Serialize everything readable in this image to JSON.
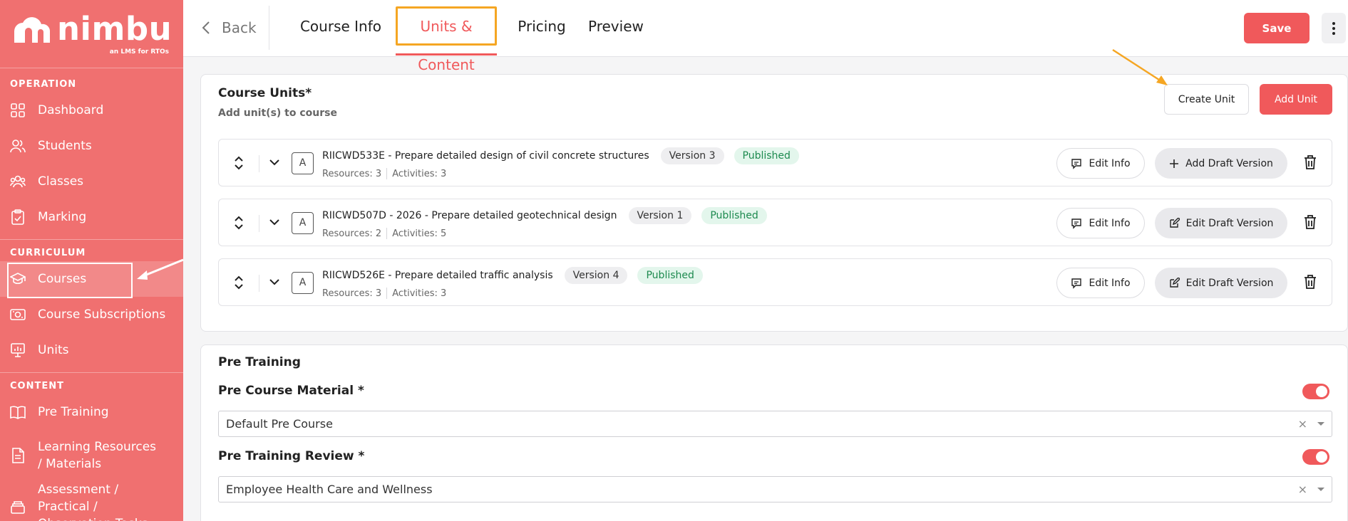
{
  "brand": {
    "name": "nimbu",
    "tagline": "an LMS for RTOs",
    "primary_color": "#f07070",
    "accent_color": "#f0595b",
    "highlight_color": "#f5a623"
  },
  "sidebar": {
    "sections": [
      {
        "label": "OPERATION",
        "items": [
          {
            "label": "Dashboard",
            "icon": "grid-icon"
          },
          {
            "label": "Students",
            "icon": "users-icon"
          },
          {
            "label": "Classes",
            "icon": "group-icon"
          },
          {
            "label": "Marking",
            "icon": "clipboard-check-icon"
          }
        ]
      },
      {
        "label": "CURRICULUM",
        "items": [
          {
            "label": "Courses",
            "icon": "graduation-cap-icon",
            "active": true
          },
          {
            "label": "Course Subscriptions",
            "icon": "subscription-icon"
          },
          {
            "label": "Units",
            "icon": "presentation-icon"
          }
        ]
      },
      {
        "label": "CONTENT",
        "items": [
          {
            "label": "Pre Training",
            "icon": "book-open-icon"
          },
          {
            "label": "Learning Resources / Materials",
            "icon": "document-icon"
          },
          {
            "label": "Assessment / Practical / Observation Tasks",
            "icon": "stack-icon"
          }
        ]
      }
    ]
  },
  "topbar": {
    "back_label": "Back",
    "tabs": [
      {
        "label": "Course Info"
      },
      {
        "label": "Units & Content",
        "active": true
      },
      {
        "label": "Pricing"
      },
      {
        "label": "Preview"
      }
    ],
    "save_label": "Save"
  },
  "course_units": {
    "title": "Course Units*",
    "subtitle": "Add unit(s) to course",
    "create_label": "Create Unit",
    "add_label": "Add Unit",
    "edit_info_label": "Edit Info",
    "units": [
      {
        "type": "A",
        "name": "RIICWD533E - Prepare detailed design of civil concrete structures",
        "version": "Version 3",
        "status": "Published",
        "resources": "Resources: 3",
        "activities": "Activities: 3",
        "draft_label": "Add Draft Version",
        "draft_icon": "plus-icon"
      },
      {
        "type": "A",
        "name": "RIICWD507D - 2026 - Prepare detailed geotechnical design",
        "version": "Version 1",
        "status": "Published",
        "resources": "Resources: 2",
        "activities": "Activities: 5",
        "draft_label": "Edit Draft Version",
        "draft_icon": "pencil-icon"
      },
      {
        "type": "A",
        "name": "RIICWD526E - Prepare detailed traffic analysis",
        "version": "Version 4",
        "status": "Published",
        "resources": "Resources: 3",
        "activities": "Activities: 3",
        "draft_label": "Edit Draft Version",
        "draft_icon": "pencil-icon"
      }
    ]
  },
  "pre_training": {
    "title": "Pre Training",
    "material_label": "Pre Course Material *",
    "material_value": "Default Pre Course",
    "review_label": "Pre Training Review *",
    "review_value": "Employee Health Care and Wellness",
    "clear_symbol": "×"
  }
}
